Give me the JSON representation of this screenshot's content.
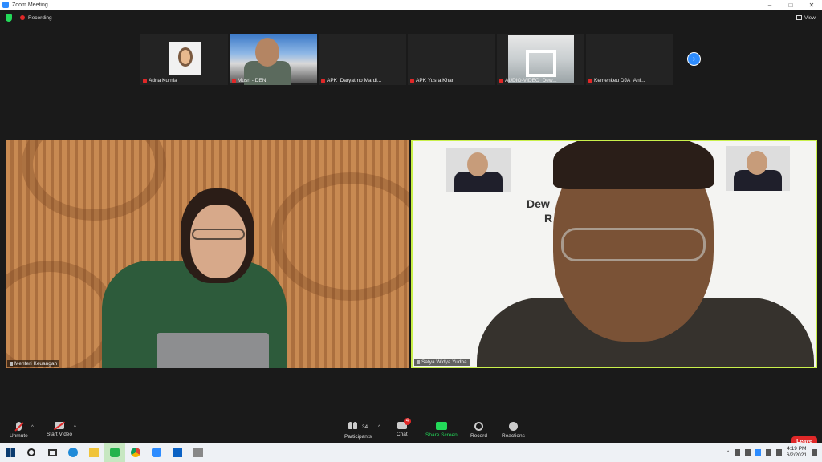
{
  "window": {
    "title": "Zoom Meeting"
  },
  "topbar": {
    "recording_label": "Recording",
    "view_label": "View"
  },
  "thumbnails": [
    {
      "name": "Adna Kurnia"
    },
    {
      "name": "Musri - DEN"
    },
    {
      "name": "APK_Daryatmo Mardi..."
    },
    {
      "name": "APK Yusra Khan"
    },
    {
      "name": "AUDIO-VIDEO_Dew..."
    },
    {
      "name": "Kemenkeu DJA_Ani..."
    }
  ],
  "main_tiles": [
    {
      "name": "Menteri Keuangan"
    },
    {
      "name": "Satya Widya Yudha"
    }
  ],
  "slide": {
    "line1": "Dew",
    "line2": "R"
  },
  "toolbar": {
    "unmute": "Unmute",
    "start_video": "Start Video",
    "participants": "Participants",
    "participants_count": "34",
    "chat": "Chat",
    "chat_badge": "4",
    "share_screen": "Share Screen",
    "record": "Record",
    "reactions": "Reactions",
    "leave": "Leave"
  },
  "taskbar": {
    "time": "4:19 PM",
    "date": "6/2/2021"
  },
  "colors": {
    "accent": "#2d8cff",
    "leave": "#e02828",
    "share": "#23d959",
    "active_speaker": "#c9f04b"
  }
}
